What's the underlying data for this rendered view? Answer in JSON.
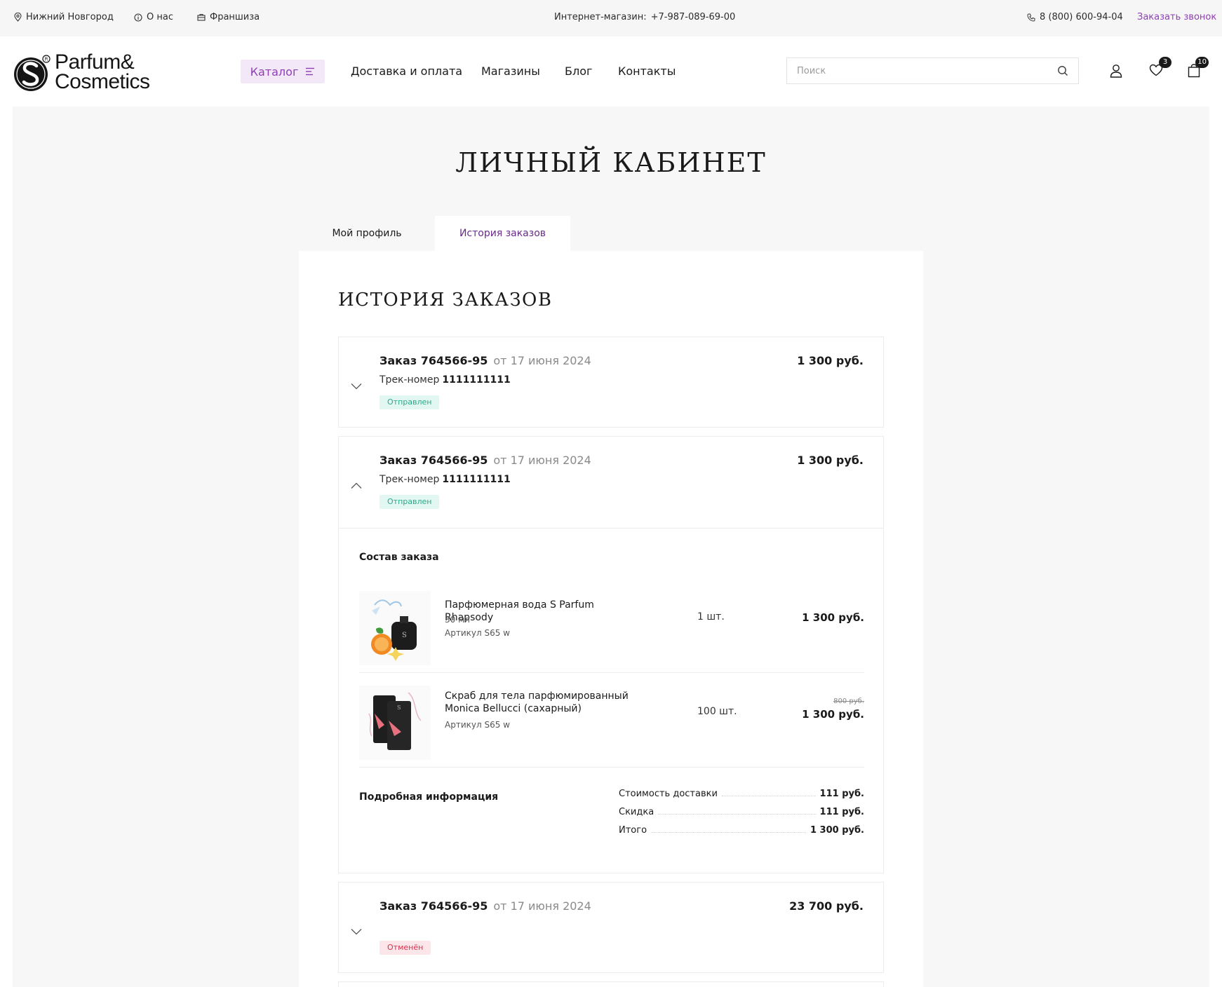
{
  "topbar": {
    "city": "Нижний Новгород",
    "about": "О нас",
    "franchise": "Франшиза",
    "shop_label": "Интернет-магазин:",
    "shop_phone": "+7-987-089-69-00",
    "phone": "8 (800) 600-94-04",
    "callback": "Заказать звонок"
  },
  "header": {
    "logo_line1": "Parfum&",
    "logo_line2": "Cosmetics",
    "catalog": "Каталог",
    "nav": [
      "Доставка и оплата",
      "Магазины",
      "Блог",
      "Контакты"
    ],
    "search_placeholder": "Поиск",
    "favorites_count": "3",
    "cart_count": "10"
  },
  "page": {
    "title": "ЛИЧНЫЙ КАБИНЕТ",
    "tabs": [
      "Мой профиль",
      "История заказов"
    ],
    "active_tab": "История заказов",
    "panel_title": "ИСТОРИЯ ЗАКАЗОВ"
  },
  "orders": [
    {
      "title": "Заказ 764566-95",
      "date": "от 17 июня 2024",
      "sum": "1 300 руб.",
      "track_label": "Трек-номер",
      "track": "1111111111",
      "status": "Отправлен",
      "expanded": false
    },
    {
      "title": "Заказ 764566-95",
      "date": "от 17 июня 2024",
      "sum": "1 300 руб.",
      "track_label": "Трек-номер",
      "track": "1111111111",
      "status": "Отправлен",
      "expanded": true,
      "details": {
        "composition_label": "Состав заказа",
        "items": [
          {
            "name": "Парфюмерная вода S Parfum Rhapsody",
            "volume": "30 мл",
            "article": "Артикул S65 w",
            "qty": "1 шт.",
            "price": "1 300 руб."
          },
          {
            "name": "Скраб для тела парфюмированный Monica Bellucci (сахарный)",
            "article": "Артикул S65 w",
            "qty": "100 шт.",
            "old_price": "800 руб.",
            "price": "1 300 руб."
          }
        ],
        "info_label": "Подробная информация",
        "summary": [
          {
            "label": "Стоимость доставки",
            "value": "111 руб."
          },
          {
            "label": "Скидка",
            "value": "111 руб."
          },
          {
            "label": "Итого",
            "value": "1 300 руб."
          }
        ]
      }
    },
    {
      "title": "Заказ 764566-95",
      "date": "от 17 июня 2024",
      "sum": "23 700 руб.",
      "status": "Отменён",
      "expanded": false
    }
  ],
  "colors": {
    "accent": "#8e3fb3",
    "status_sent_bg": "#e3f7f2",
    "status_sent_text": "#2aa98a",
    "status_cancel_bg": "#fde6ea",
    "status_cancel_text": "#d9304f"
  }
}
